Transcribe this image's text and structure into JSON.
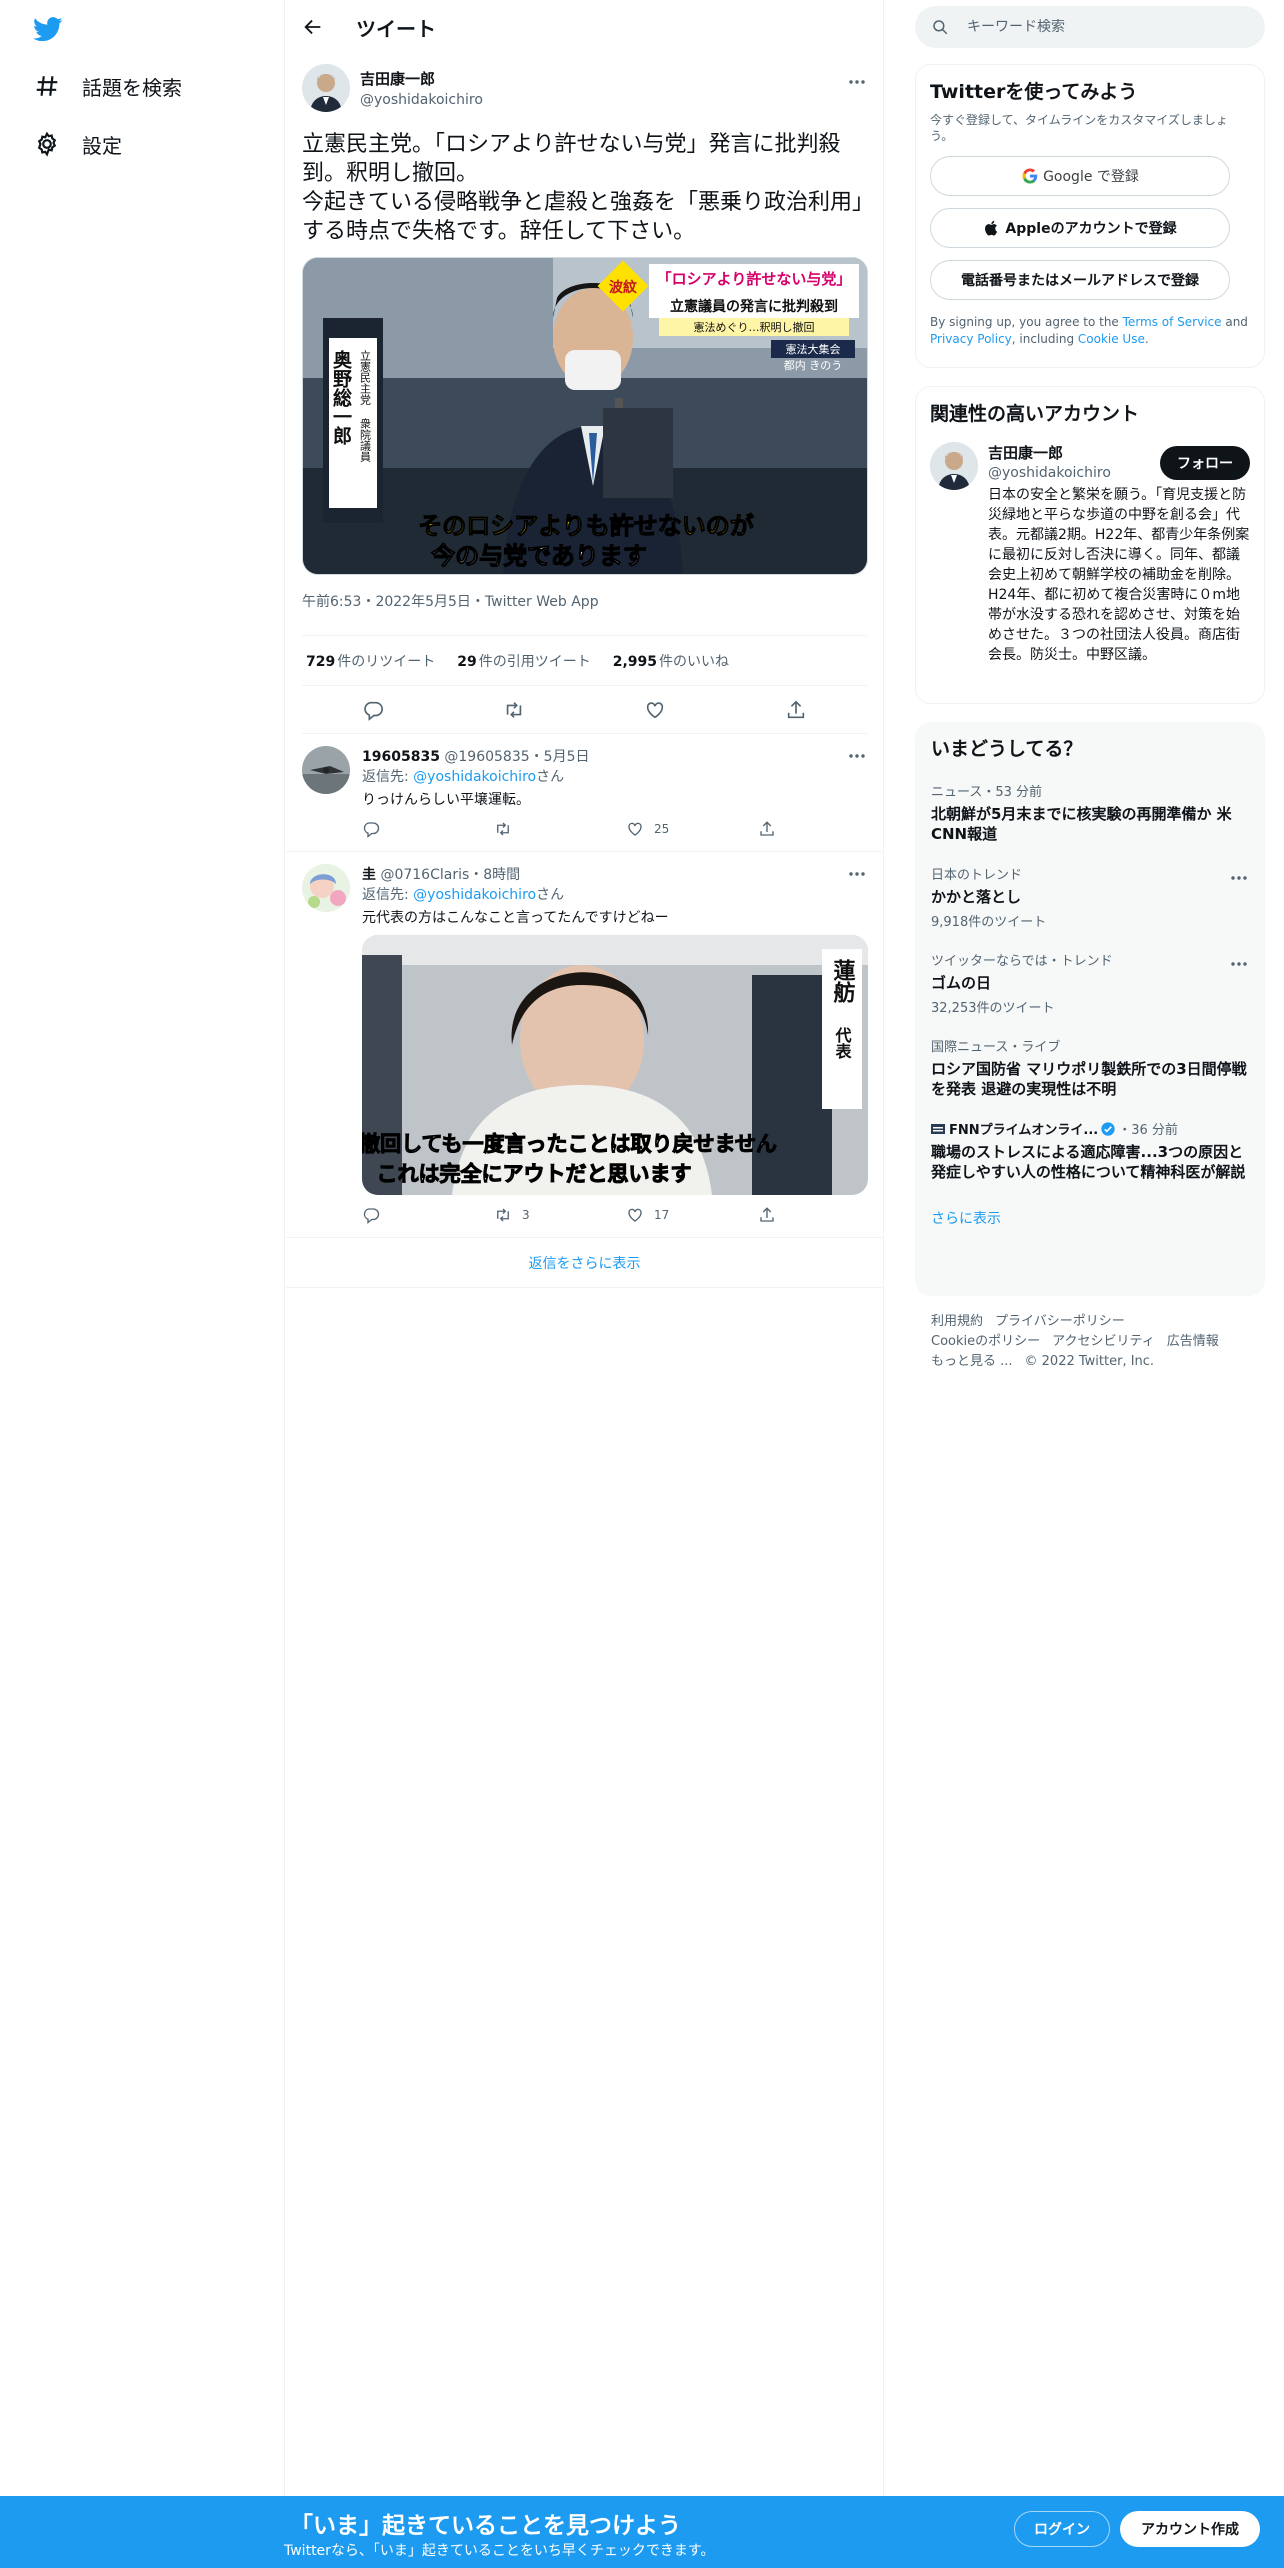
{
  "nav": {
    "explore_label": "話題を検索",
    "settings_label": "設定"
  },
  "header": {
    "title": "ツイート"
  },
  "tweet": {
    "author_name": "吉田康一郎",
    "author_handle": "@yoshidakoichiro",
    "text": "立憲民主党。「ロシアより許せない与党」発言に批判殺到。釈明し撤回。\n今起きている侵略戦争と虐殺と強姦を「悪乗り政治利用」する時点で失格です。辞任して下さい。",
    "media": {
      "caption_tag": "波紋",
      "caption_headline": "「ロシアより許せない与党」",
      "caption_sub": "立憲議員の発言に批判殺到",
      "caption_note": "憲法めぐり…釈明し撤回",
      "event_label": "憲法大集会",
      "event_place": "都内 きのう",
      "name_side": "立憲民主党",
      "name_big": "奥野総一郎",
      "name_role": "衆院議員",
      "subtitle_line1": "そのロシアよりも許せないのが",
      "subtitle_line2": "今の与党であります"
    },
    "meta": "午前6:53・2022年5月5日・Twitter Web App",
    "retweets_count": "729",
    "retweets_label": "件のリツイート",
    "quotes_count": "29",
    "quotes_label": "件の引用ツイート",
    "likes_count": "2,995",
    "likes_label": "件のいいね"
  },
  "replies": [
    {
      "name": "19605835",
      "handle": "@19605835",
      "time": "・5月5日",
      "reply_to_prefix": "返信先: ",
      "reply_to_handle": "@yoshidakoichiro",
      "reply_to_suffix": "さん",
      "text": "りっけんらしい平壌運転。",
      "retweet_count": "",
      "like_count": "25"
    },
    {
      "name": "圭",
      "handle": "@0716Claris",
      "time": "・8時間",
      "reply_to_prefix": "返信先: ",
      "reply_to_handle": "@yoshidakoichiro",
      "reply_to_suffix": "さん",
      "text": "元代表の方はこんなこと言ってたんですけどねー",
      "retweet_count": "3",
      "like_count": "17",
      "media": {
        "name_tag_top": "蓮舫",
        "name_tag_bottom": "代表",
        "subtitle_line1": "撤回しても一度言ったことは取り戻せません",
        "subtitle_line2": "これは完全にアウトだと思います"
      }
    }
  ],
  "show_more_replies": "返信をさらに表示",
  "search": {
    "placeholder": "キーワード検索"
  },
  "signup_card": {
    "title": "Twitterを使ってみよう",
    "subtitle": "今すぐ登録して、タイムラインをカスタマイズしましょう。",
    "google_label": "Google で登録",
    "apple_label": "Appleのアカウントで登録",
    "phone_label": "電話番号またはメールアドレスで登録",
    "terms_prefix": "By signing up, you agree to the ",
    "terms_tos": "Terms of Service",
    "terms_and": " and ",
    "terms_privacy": "Privacy Policy",
    "terms_including": ", including ",
    "terms_cookie": "Cookie Use",
    "terms_end": "."
  },
  "related_card": {
    "title": "関連性の高いアカウント",
    "name": "吉田康一郎",
    "handle": "@yoshidakoichiro",
    "follow_label": "フォロー",
    "bio": "日本の安全と繁栄を願う。「育児支援と防災緑地と平らな歩道の中野を創る会」代表。元都議2期。H22年、都青少年条例案に最初に反対し否決に導く。同年、都議会史上初めて朝鮮学校の補助金を削除。H24年、都に初めて複合災害時に０m地帯が水没する恐れを認めさせ、対策を始めさせた。３つの社団法人役員。商店街会長。防災士。中野区議。"
  },
  "trends_card": {
    "title": "いまどうしてる？",
    "items": [
      {
        "context": "ニュース・53 分前",
        "title": "北朝鮮が5月末までに核実験の再開準備か 米CNN報道",
        "count": ""
      },
      {
        "context": "日本のトレンド",
        "title": "かかと落とし",
        "count": "9,918件のツイート"
      },
      {
        "context": "ツイッターならでは・トレンド",
        "title": "ゴムの日",
        "count": "32,253件のツイート"
      },
      {
        "context": "国際ニュース・ライブ",
        "title": "ロシア国防省 マリウポリ製鉄所での3日間停戦を発表 退避の実現性は不明",
        "count": ""
      }
    ],
    "news_source": "FNNプライムオンライ...",
    "news_time": "・36 分前",
    "news_title": "職場のストレスによる適応障害...3つの原因と発症しやすい人の性格について精神科医が解説",
    "show_more": "さらに表示"
  },
  "footer": {
    "terms": "利用規約",
    "privacy": "プライバシーポリシー",
    "cookie": "Cookieのポリシー",
    "accessibility": "アクセシビリティ",
    "ads": "広告情報",
    "more": "もっと見る ...",
    "copyright": "© 2022 Twitter, Inc."
  },
  "bottom_bar": {
    "title": "「いま」起きていることを見つけよう",
    "subtitle": "Twitterなら、「いま」起きていることをいち早くチェックできます。",
    "login_label": "ログイン",
    "signup_label": "アカウント作成"
  },
  "colors": {
    "brand_blue": "#1d9bf0",
    "text_primary": "#0f1419",
    "text_secondary": "#536471",
    "border": "#eff3f4"
  }
}
